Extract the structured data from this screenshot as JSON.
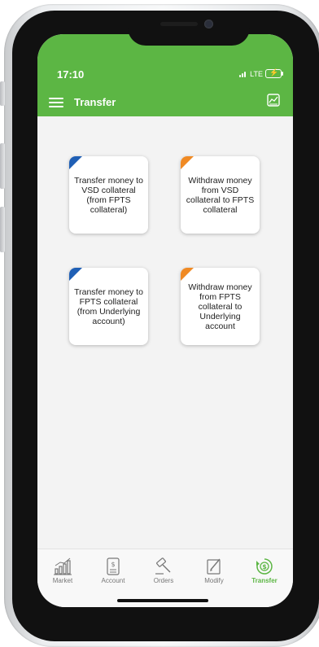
{
  "status": {
    "time": "17:10",
    "network": "LTE"
  },
  "header": {
    "title": "Transfer"
  },
  "tiles": [
    {
      "label": "Transfer money to VSD collateral (from FPTS collateral)",
      "corner_color": "#1f5fb5"
    },
    {
      "label": "Withdraw money from VSD collateral to FPTS collateral",
      "corner_color": "#f08a24"
    },
    {
      "label": "Transfer money to FPTS collateral (from Underlying account)",
      "corner_color": "#1f5fb5"
    },
    {
      "label": "Withdraw money from FPTS collateral to Underlying account",
      "corner_color": "#f08a24"
    }
  ],
  "nav": [
    {
      "label": "Market",
      "icon": "market-icon"
    },
    {
      "label": "Account",
      "icon": "account-icon"
    },
    {
      "label": "Orders",
      "icon": "orders-icon"
    },
    {
      "label": "Modify",
      "icon": "modify-icon"
    },
    {
      "label": "Transfer",
      "icon": "transfer-icon",
      "active": true
    }
  ],
  "colors": {
    "brand_green": "#5cb644",
    "blue_accent": "#1f5fb5",
    "orange_accent": "#f08a24"
  }
}
